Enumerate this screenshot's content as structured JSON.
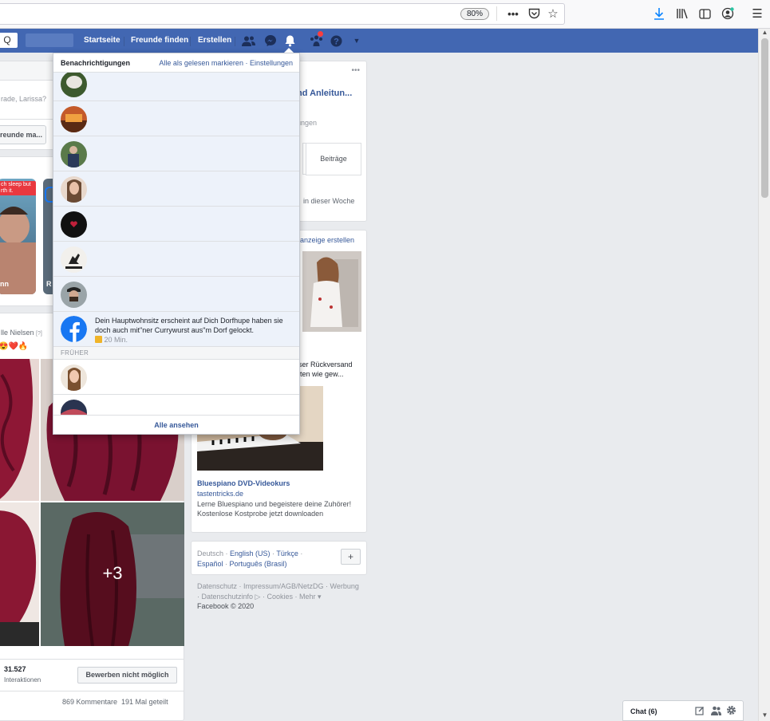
{
  "browser": {
    "zoom": "80%",
    "icons": [
      "more-icon",
      "pocket-icon",
      "bookmark-star-icon",
      "download-icon",
      "library-icon",
      "sidebar-icon",
      "account-icon",
      "hamburger-menu-icon"
    ]
  },
  "header": {
    "search_partial": "Q",
    "nav": [
      "Startseite",
      "Freunde finden",
      "Erstellen"
    ]
  },
  "composer": {
    "placeholder_partial": "rade, Larissa?",
    "friends_button_partial": "reunde ma..."
  },
  "stories": {
    "story1_caption": "ch sleep but\nrth it.",
    "story1_name_partial": "nn",
    "story2_name_partial": "R"
  },
  "post": {
    "author_partial": "lle Nielsen",
    "author_tag": "[?]",
    "reactions_partial": "😍❤️🔥",
    "more_photos": "+3",
    "interactions_count": "31.527",
    "interactions_label": "Interaktionen",
    "apply_button": "Bewerben nicht möglich",
    "stats": "869 Kommentare  191 Mal geteilt"
  },
  "notifications": {
    "title": "Benachrichtigungen",
    "mark_read": "Alle als gelesen markieren",
    "settings": "Einstellungen",
    "fb_notif_text": "Dein Hauptwohnsitz erscheint auf Dich Dorfhupe haben sie doch auch mit\"ner Currywurst aus\"m Dorf gelockt.",
    "fb_notif_time": "20 Min.",
    "earlier_label": "FRÜHER",
    "see_all": "Alle ansehen"
  },
  "right": {
    "page_card": {
      "title_partial": "nd Anleitun...",
      "subtitle_partial": "ungen",
      "posts_button": "Beiträge",
      "week_text_partial": "in dieser Woche"
    },
    "ads": {
      "create_ad_partial": "eanzeige erstellen",
      "ad1_text_partial": "ser Rückversand\niten wie gew...",
      "ad2_title": "Bluespiano DVD-Videokurs",
      "ad2_domain": "tastentricks.de",
      "ad2_desc": "Lerne Bluespiano und begeistere deine Zuhörer! Kostenlose Kostprobe jetzt downloaden"
    },
    "languages": {
      "current": "Deutsch",
      "others_line1": [
        "English (US)",
        "Türkçe"
      ],
      "others_line2": [
        "Español",
        "Português (Brasil)"
      ],
      "add": "+"
    },
    "footer_links": "Datenschutz · Impressum/AGB/NetzDG · Werbung · Datenschutzinfo ▷ · Cookies · Mehr ▾",
    "copyright": "Facebook © 2020"
  },
  "chat": {
    "label": "Chat (6)"
  },
  "colors": {
    "fb_blue": "#4267b2",
    "link_blue": "#365899",
    "unread_bg": "#edf2fa"
  }
}
